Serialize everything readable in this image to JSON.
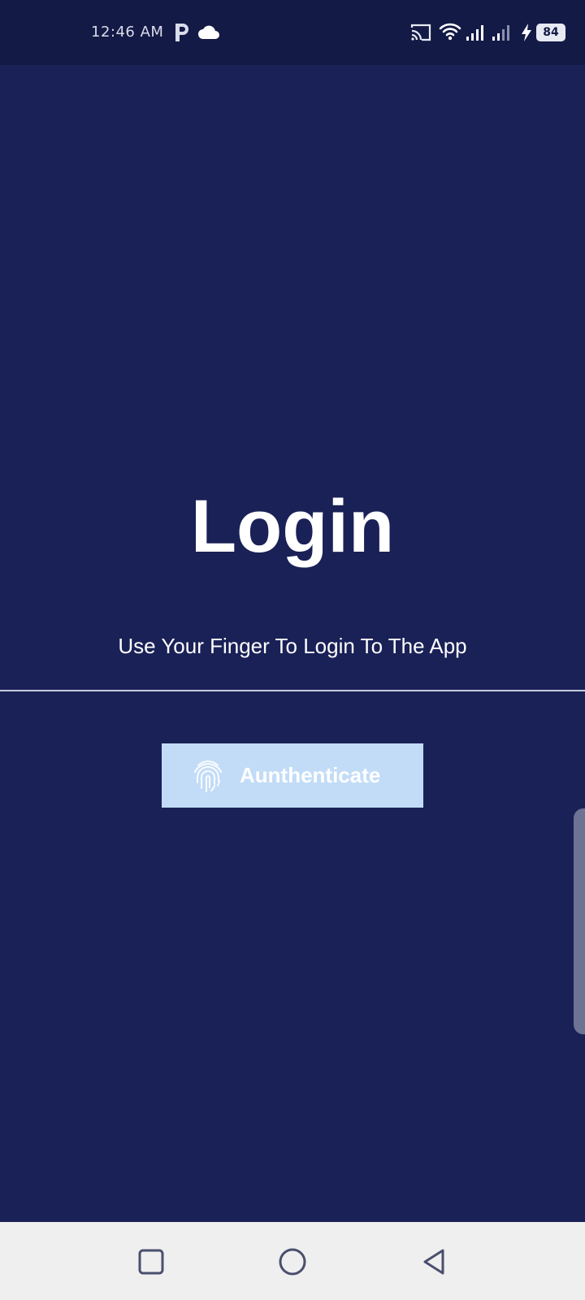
{
  "status_bar": {
    "time": "12:46 AM",
    "battery": "84",
    "icons": [
      "p-app-icon",
      "cloud-icon",
      "cast-icon",
      "wifi-icon",
      "signal-icon",
      "signal-icon",
      "charging-icon",
      "battery-icon"
    ]
  },
  "login": {
    "title": "Login",
    "subtitle": "Use Your Finger To Login To The App",
    "button_label": "Aunthenticate",
    "button_icon": "fingerprint-icon"
  },
  "nav_bar": {
    "buttons": [
      "recent-apps",
      "home",
      "back"
    ]
  },
  "colors": {
    "background": "#1a2157",
    "status_bar": "#141a46",
    "button": "#c2dcf7",
    "nav_bar": "#efefef"
  }
}
